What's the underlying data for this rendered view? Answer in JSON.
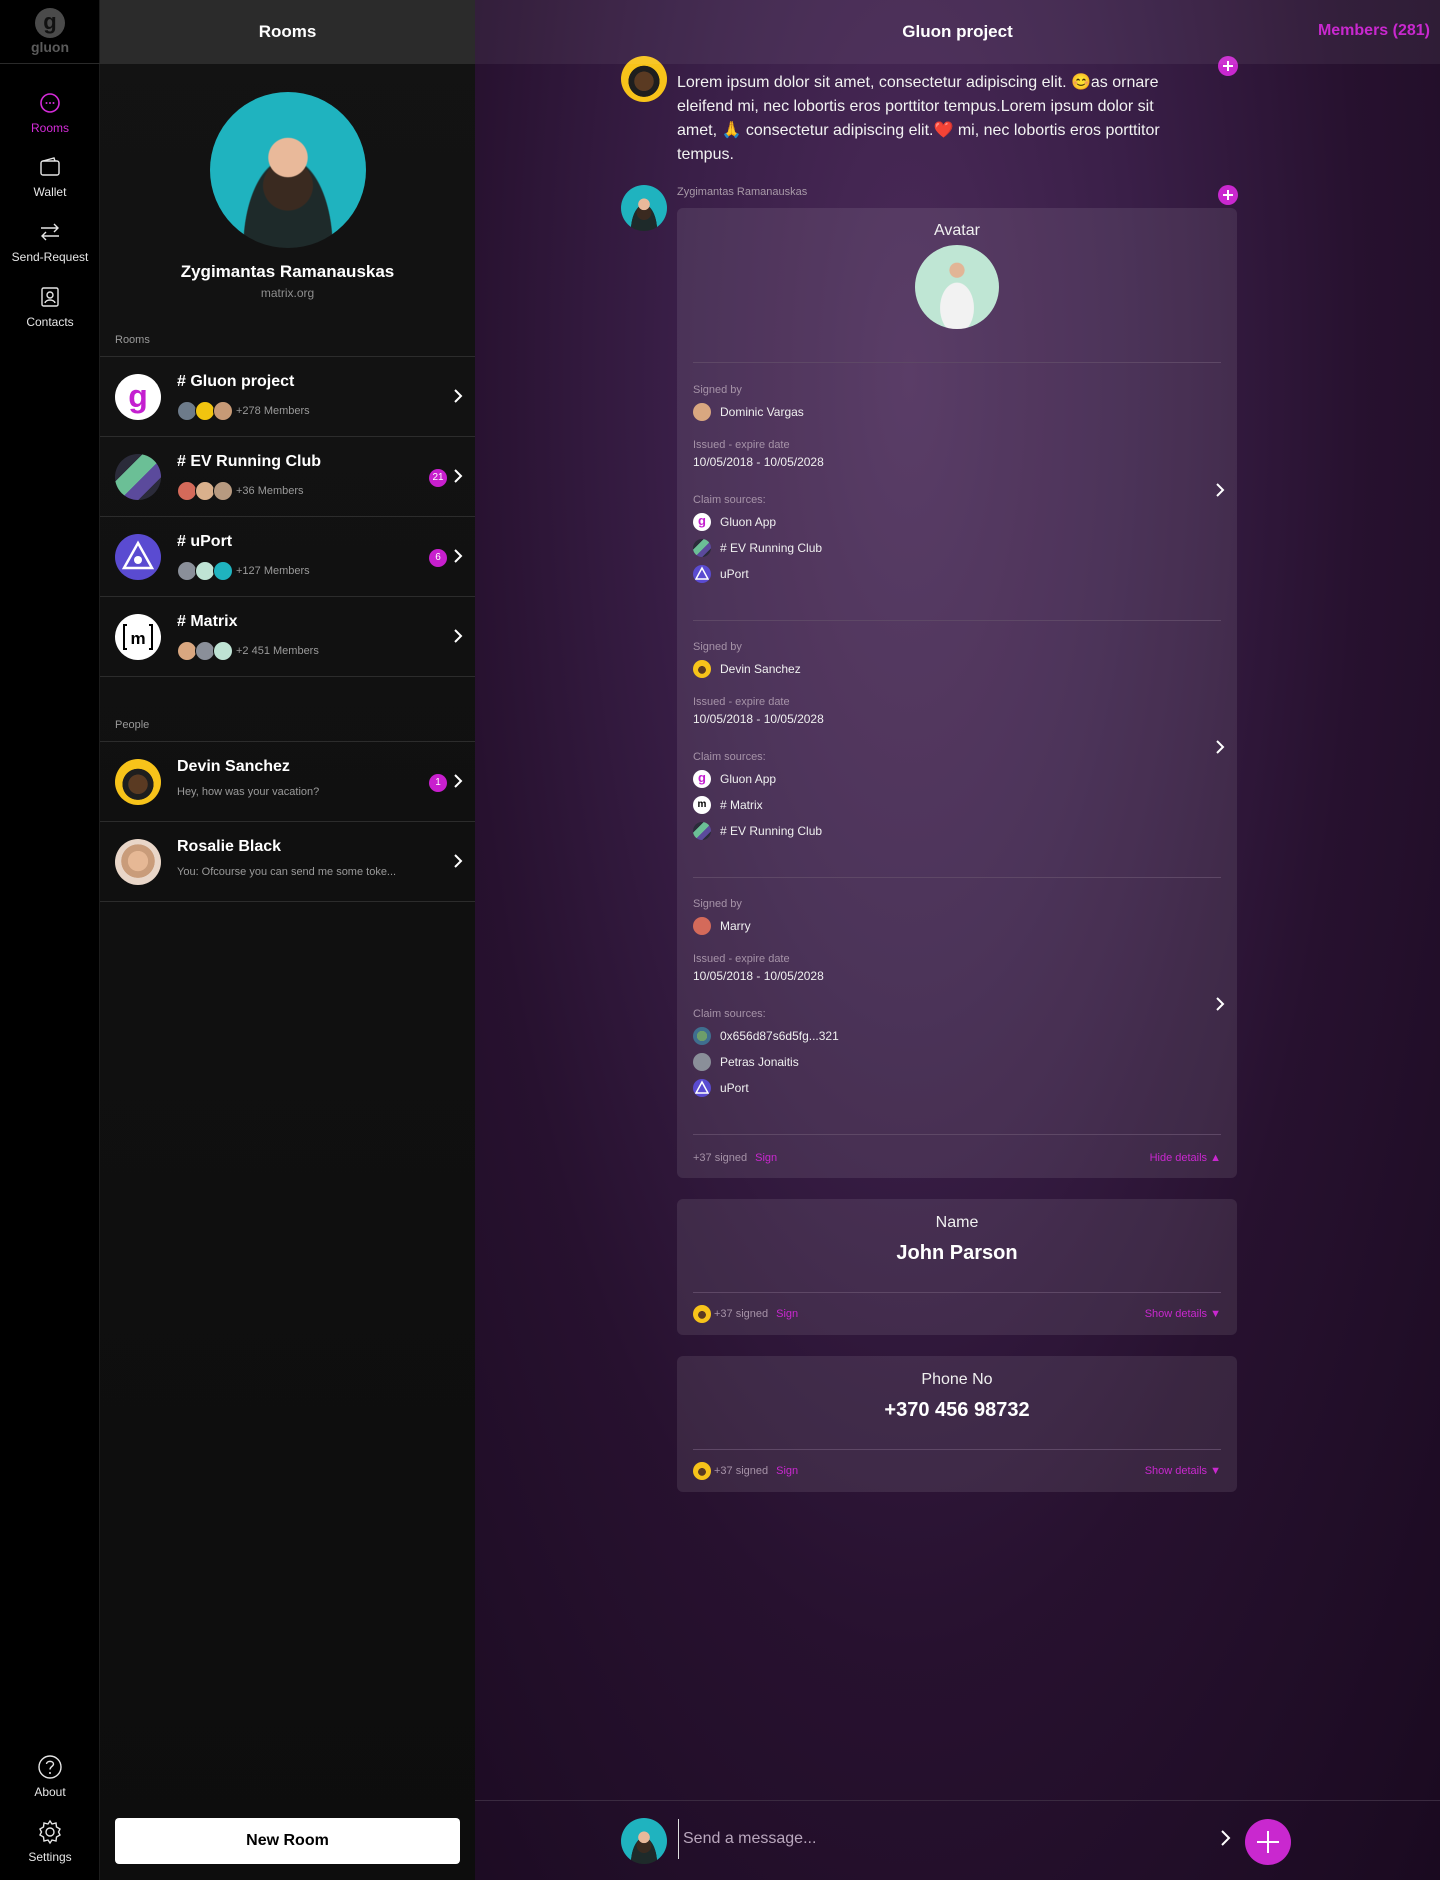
{
  "nav": {
    "logo_text": "gluon",
    "items": [
      {
        "label": "Rooms",
        "icon": "chat-bubble-icon",
        "active": true
      },
      {
        "label": "Wallet",
        "icon": "wallet-icon"
      },
      {
        "label": "Send-Request",
        "icon": "swap-arrows-icon"
      },
      {
        "label": "Contacts",
        "icon": "contacts-icon"
      }
    ],
    "bottom": [
      {
        "label": "About",
        "icon": "question-icon"
      },
      {
        "label": "Settings",
        "icon": "gear-icon"
      }
    ]
  },
  "rooms_panel": {
    "title": "Rooms",
    "profile": {
      "name": "Zygimantas Ramanauskas",
      "server": "matrix.org"
    },
    "rooms_label": "Rooms",
    "rooms": [
      {
        "title": "# Gluon project",
        "members": "+278 Members",
        "badge": ""
      },
      {
        "title": "# EV Running Club",
        "members": "+36 Members",
        "badge": "21"
      },
      {
        "title": "# uPort",
        "members": "+127 Members",
        "badge": "6"
      },
      {
        "title": "# Matrix",
        "members": "+2 451 Members",
        "badge": ""
      }
    ],
    "people_label": "People",
    "people": [
      {
        "name": "Devin Sanchez",
        "preview": "Hey, how was your vacation?",
        "badge": "1"
      },
      {
        "name": "Rosalie Black",
        "preview": "You: Ofcourse you can send me some toke...",
        "badge": ""
      }
    ],
    "new_room": "New Room"
  },
  "main": {
    "title": "Gluon project",
    "members": "Members (281)",
    "message1": {
      "text": "Lorem ipsum dolor sit amet, consectetur adipiscing elit. 😊as ornare eleifend mi, nec lobortis eros porttitor tempus.Lorem ipsum dolor sit amet, 🙏 consectetur adipiscing elit.❤️ mi, nec lobortis eros porttitor tempus."
    },
    "message2": {
      "sender": "Zygimantas Ramanauskas",
      "avatar_card": {
        "title": "Avatar",
        "signatures": [
          {
            "signed_by_label": "Signed by",
            "signer": "Dominic Vargas",
            "date_label": "Issued - expire date",
            "date": "10/05/2018 - 10/05/2028",
            "sources_label": "Claim sources:",
            "sources": [
              "Gluon App",
              "# EV Running Club",
              "uPort"
            ]
          },
          {
            "signed_by_label": "Signed by",
            "signer": "Devin Sanchez",
            "date_label": "Issued - expire date",
            "date": "10/05/2018 - 10/05/2028",
            "sources_label": "Claim sources:",
            "sources": [
              "Gluon App",
              "# Matrix",
              "# EV Running Club"
            ]
          },
          {
            "signed_by_label": "Signed by",
            "signer": "Marry",
            "date_label": "Issued - expire date",
            "date": "10/05/2018 - 10/05/2028",
            "sources_label": "Claim sources:",
            "sources": [
              "0x656d87s6d5fg...321",
              "Petras Jonaitis",
              "uPort"
            ]
          }
        ],
        "signed_count": "+37 signed",
        "sign": "Sign",
        "details": "Hide details ▲"
      },
      "name_card": {
        "title": "Name",
        "value": "John Parson",
        "signed_count": "+37 signed",
        "sign": "Sign",
        "details": "Show details ▼"
      },
      "phone_card": {
        "title": "Phone No",
        "value": "+370 456 98732",
        "signed_count": "+37 signed",
        "sign": "Sign",
        "details": "Show details ▼"
      }
    },
    "composer": {
      "placeholder": "Send a message..."
    }
  },
  "colors": {
    "accent": "#c928cf",
    "panel": "#131313",
    "header": "#2b2b2b"
  }
}
